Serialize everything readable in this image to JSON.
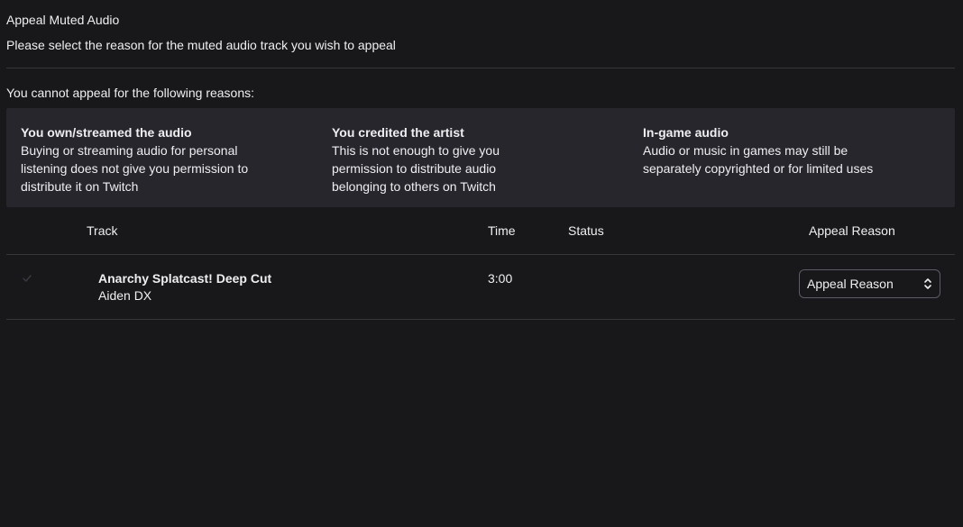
{
  "header": {
    "title": "Appeal Muted Audio",
    "subtitle": "Please select the reason for the muted audio track you wish to appeal"
  },
  "restrictions": {
    "heading": "You cannot appeal for the following reasons:",
    "items": [
      {
        "title": "You own/streamed the audio",
        "body": "Buying or streaming audio for personal listening does not give you permission to distribute it on Twitch"
      },
      {
        "title": "You credited the artist",
        "body": "This is not enough to give you permission to distribute audio belonging to others on Twitch"
      },
      {
        "title": "In-game audio",
        "body": "Audio or music in games may still be separately copyrighted or for limited uses"
      }
    ]
  },
  "table": {
    "columns": {
      "track": "Track",
      "time": "Time",
      "status": "Status",
      "appeal_reason": "Appeal Reason"
    },
    "rows": [
      {
        "title": "Anarchy Splatcast! Deep Cut",
        "artist": "Aiden DX",
        "time": "3:00",
        "status": "",
        "appeal_select": {
          "selected": "Appeal Reason"
        }
      }
    ]
  },
  "icons": {
    "row_check": "checkmark-icon",
    "select_arrows": "chevron-up-down-icon"
  },
  "colors": {
    "background": "#18181b",
    "panel": "#26262c",
    "divider": "#35353b",
    "text": "#efeff1",
    "select_border": "#5c5c66",
    "check_muted": "#3a3a42"
  }
}
